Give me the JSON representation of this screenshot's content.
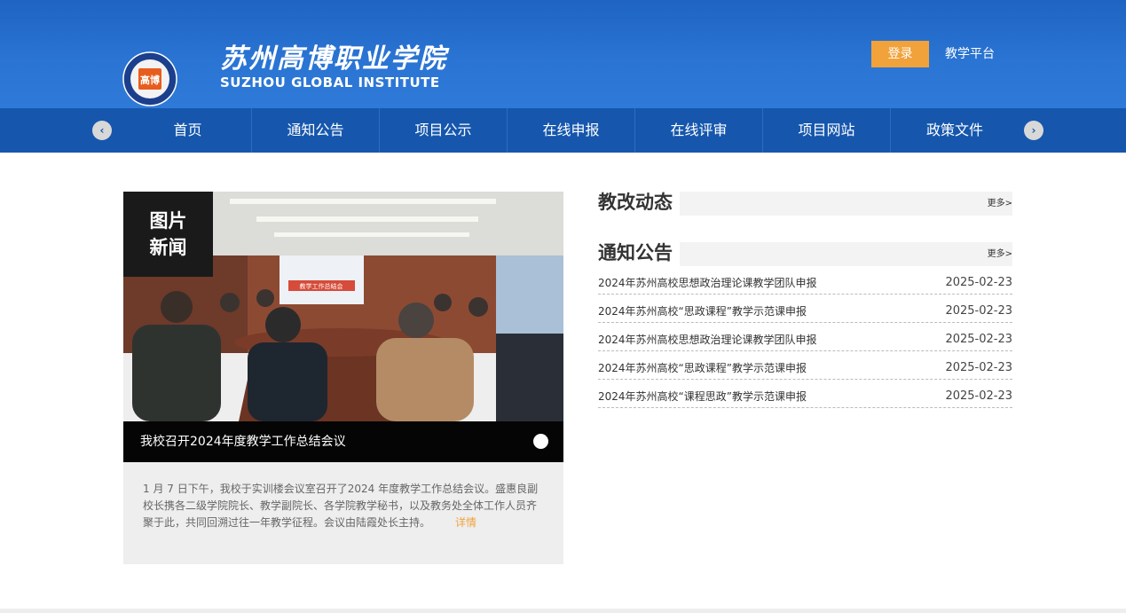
{
  "header": {
    "logo_cn": "苏州高博职业学院",
    "logo_en": "SUZHOU GLOBAL INSTITUTE",
    "seal_glyph": "高博",
    "login_label": "登录",
    "platform_label": "教学平台"
  },
  "nav": {
    "prev_icon": "‹",
    "next_icon": "›",
    "items": [
      {
        "label": "首页"
      },
      {
        "label": "通知公告"
      },
      {
        "label": "项目公示"
      },
      {
        "label": "在线申报"
      },
      {
        "label": "在线评审"
      },
      {
        "label": "项目网站"
      },
      {
        "label": "政策文件"
      }
    ]
  },
  "news": {
    "tag_line1": "图片",
    "tag_line2": "新闻",
    "caption": "我校召开2024年度教学工作总结会议",
    "banner_text": "教学工作总结会",
    "summary": "1 月 7 日下午，我校于实训楼会议室召开了2024 年度教学工作总结会议。盛惠良副校长携各二级学院院长、教学副院长、各学院教学秘书，以及教务处全体工作人员齐聚于此，共同回溯过往一年教学征程。会议由陆霞处长主持。",
    "detail_label": "详情"
  },
  "reform": {
    "title": "教改动态",
    "more": "更多>"
  },
  "notices": {
    "title": "通知公告",
    "more": "更多>",
    "items": [
      {
        "title": "2024年苏州高校思想政治理论课教学团队申报",
        "date": "2025-02-23"
      },
      {
        "title": "2024年苏州高校“思政课程”教学示范课申报",
        "date": "2025-02-23"
      },
      {
        "title": "2024年苏州高校思想政治理论课教学团队申报",
        "date": "2025-02-23"
      },
      {
        "title": "2024年苏州高校“思政课程”教学示范课申报",
        "date": "2025-02-23"
      },
      {
        "title": "2024年苏州高校“课程思政”教学示范课申报",
        "date": "2025-02-23"
      }
    ]
  },
  "colors": {
    "header_blue": "#2a74d3",
    "nav_blue": "#1657ad",
    "accent_orange": "#f1a23a"
  }
}
